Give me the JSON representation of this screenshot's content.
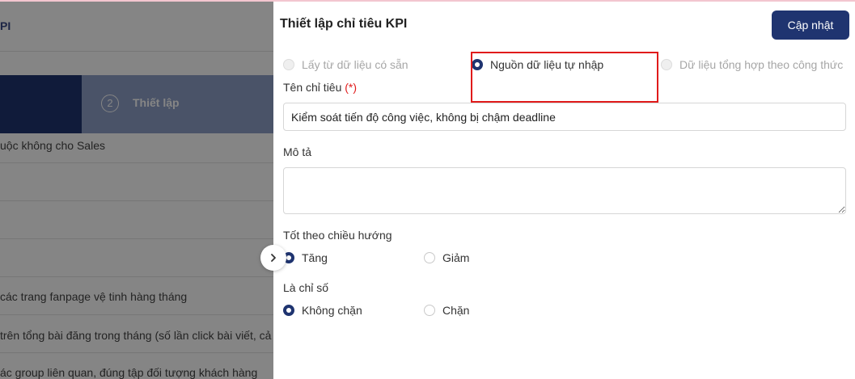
{
  "background": {
    "title": "PI",
    "steps": [
      {
        "number": "2",
        "label": "Thiết lập"
      }
    ],
    "rows": [
      "uộc không cho Sales",
      "các trang fanpage vệ tinh hàng tháng",
      "trên tổng bài đăng trong tháng (số lần click bài viết, cả",
      "ác group liên quan, đúng tập đối tượng khách hàng"
    ]
  },
  "panel": {
    "title": "Thiết lập chỉ tiêu KPI",
    "update_label": "Cập nhật",
    "source_options": [
      {
        "label": "Lấy từ dữ liệu có sẵn",
        "state": "disabled"
      },
      {
        "label": "Nguồn dữ liệu tự nhập",
        "state": "checked"
      },
      {
        "label": "Dữ liệu tổng hợp theo công thức",
        "state": "disabled"
      }
    ],
    "name_label": "Tên chỉ tiêu",
    "required_mark": "(*)",
    "name_value": "Kiểm soát tiến độ công việc, không bị chậm deadline",
    "description_label": "Mô tả",
    "description_value": "",
    "direction_label": "Tốt theo chiều hướng",
    "direction_options": [
      {
        "label": "Tăng",
        "checked": true
      },
      {
        "label": "Giảm",
        "checked": false
      }
    ],
    "indicator_label": "Là chỉ số",
    "indicator_options": [
      {
        "label": "Không chặn",
        "checked": true
      },
      {
        "label": "Chặn",
        "checked": false
      }
    ]
  },
  "colors": {
    "primary": "#1f3470",
    "highlight": "#e01b1b",
    "required": "#e01b1b"
  },
  "icons": {
    "collapse": "chevron-right-icon"
  }
}
